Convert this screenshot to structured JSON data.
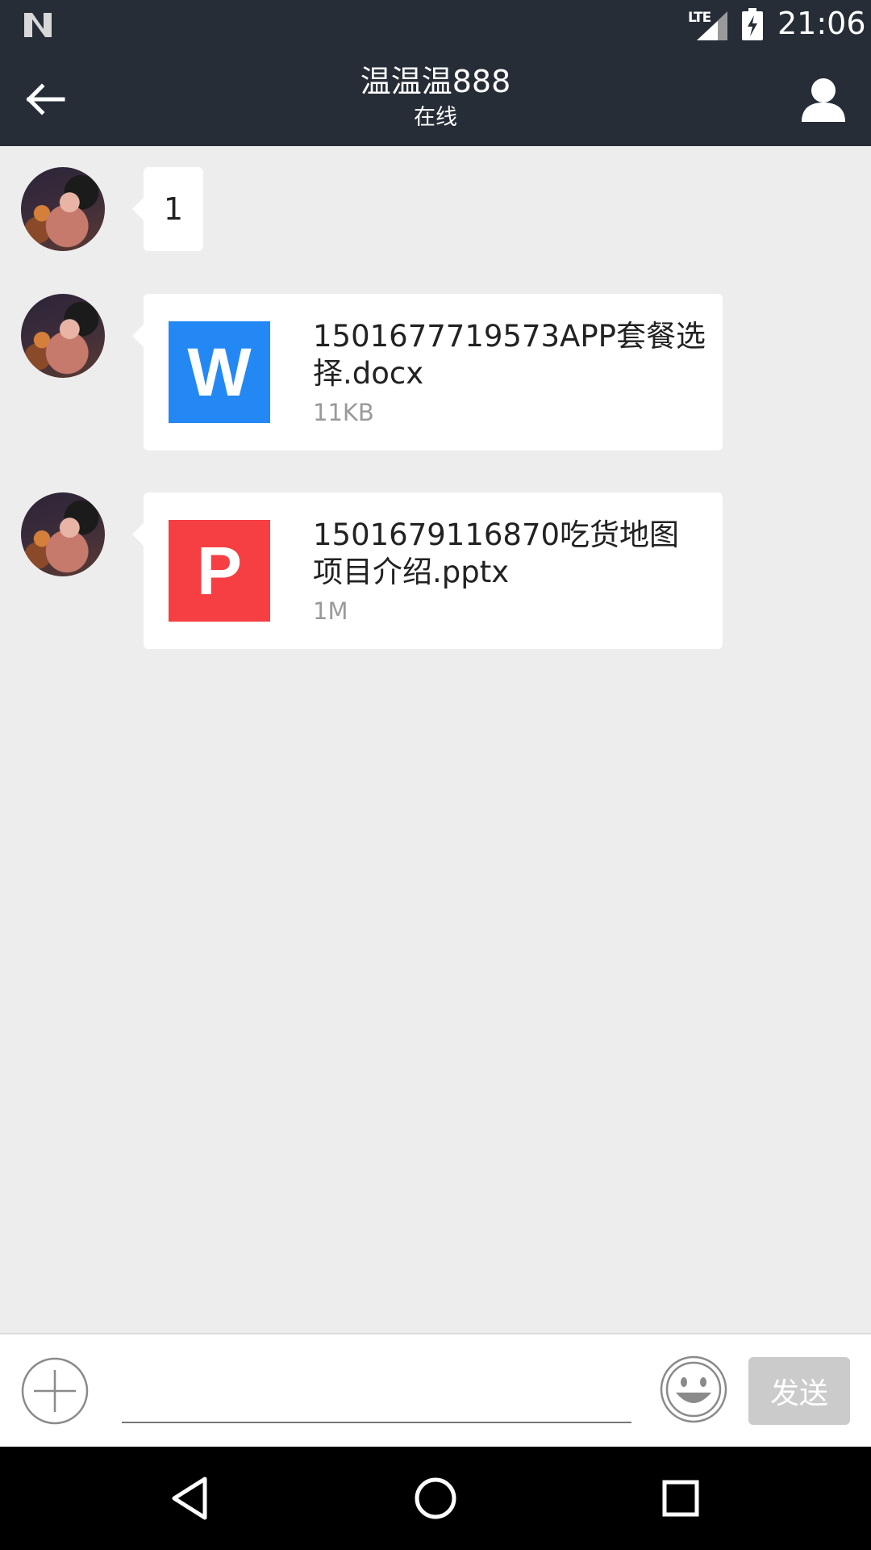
{
  "status_bar": {
    "network": "LTE",
    "time": "21:06"
  },
  "header": {
    "title": "温温温888",
    "subtitle": "在线"
  },
  "messages": [
    {
      "type": "text",
      "text": "1"
    },
    {
      "type": "file",
      "file_type": "word",
      "icon_letter": "W",
      "icon_color": "#2388f4",
      "file_name": "1501677719573APP套餐选择.docx",
      "file_size": "11KB"
    },
    {
      "type": "file",
      "file_type": "ppt",
      "icon_letter": "P",
      "icon_color": "#f53f42",
      "file_name": "1501679116870吃货地图项目介绍.pptx",
      "file_size": "1M"
    }
  ],
  "composer": {
    "input_value": "",
    "send_label": "发送"
  },
  "colors": {
    "header_bg": "#262d37",
    "chat_bg": "#ededed",
    "send_disabled": "#cbcbcb"
  },
  "icons": {
    "back": "arrow-left-icon",
    "profile": "person-icon",
    "add": "plus-circle-icon",
    "emoji": "smiley-icon",
    "nav_back": "triangle-back-icon",
    "nav_home": "circle-home-icon",
    "nav_recents": "square-recents-icon"
  }
}
